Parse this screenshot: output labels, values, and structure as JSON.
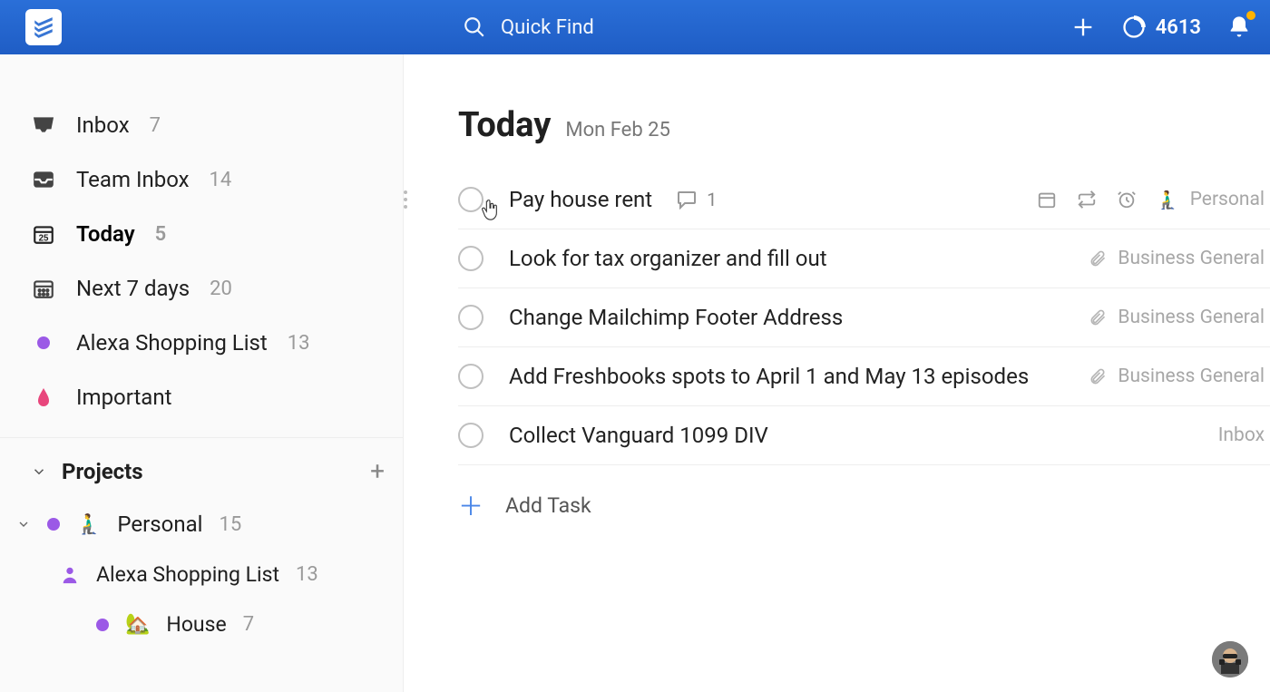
{
  "header": {
    "search_placeholder": "Quick Find",
    "karma": "4613"
  },
  "sidebar": {
    "inbox": {
      "label": "Inbox",
      "count": "7"
    },
    "teamInbox": {
      "label": "Team Inbox",
      "count": "14"
    },
    "today": {
      "label": "Today",
      "count": "5"
    },
    "next7": {
      "label": "Next 7 days",
      "count": "20"
    },
    "alexa": {
      "label": "Alexa Shopping List",
      "count": "13"
    },
    "important": {
      "label": "Important"
    },
    "projects_label": "Projects",
    "projects": {
      "p1_label": "Personal",
      "p1_count": "15",
      "p1a_label": "Alexa Shopping List",
      "p1a_count": "13",
      "p1b_label": "House",
      "p1b_count": "7"
    }
  },
  "view": {
    "title": "Today",
    "subtitle": "Mon Feb 25",
    "add_task_label": "Add Task"
  },
  "tasks": [
    {
      "title": "Pay house rent",
      "comments": "1",
      "project": "Personal",
      "icon": "person"
    },
    {
      "title": "Look for tax organizer and fill out",
      "project": "Business General",
      "icon": "clip"
    },
    {
      "title": "Change Mailchimp Footer Address",
      "project": "Business General",
      "icon": "clip"
    },
    {
      "title": "Add Freshbooks spots to April 1 and May 13 episodes",
      "project": "Business General",
      "icon": "clip"
    },
    {
      "title": "Collect Vanguard 1099 DIV",
      "project": "Inbox",
      "icon": "none"
    }
  ]
}
